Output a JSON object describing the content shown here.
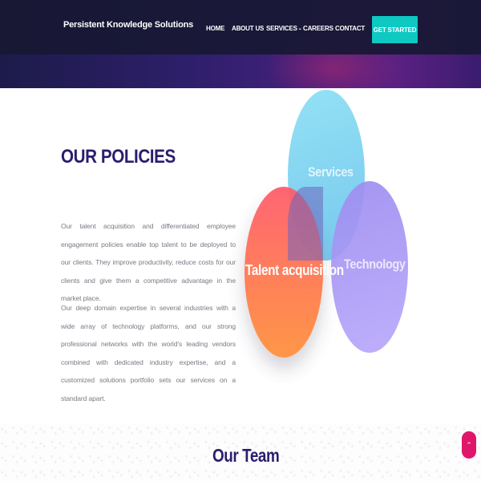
{
  "brand": {
    "name": "Persistent Knowledge Solutions"
  },
  "nav": {
    "items": [
      "HOME",
      "ABOUT US",
      "SERVICES",
      "CAREERS",
      "CONTACT"
    ],
    "cta_label": "GET STARTED"
  },
  "policies": {
    "title": "OUR POLICIES",
    "paragraphs": [
      "Our talent acquisition and differentiated employee engagement policies enable top talent to be deployed to our clients. They improve productivity, reduce costs for our clients and give them a competitive advantage in the market place.",
      "Our deep domain expertise in several industries with a wide array of technology platforms, and our strong professional networks with the world's leading vendors combined with dedicated industry expertise, and a customized solutions portfolio sets our services on a standard apart."
    ]
  },
  "venn": {
    "services": "Services",
    "technology": "Technology",
    "talent": "Talent acquisition",
    "colors": {
      "services": "#8ee0f5",
      "technology": "#a897f5",
      "talent": "#ff6a55"
    }
  },
  "team": {
    "title": "Our Team"
  },
  "scroll_top": {
    "icon": "chevron-up-icon",
    "glyph": "⌃"
  },
  "colors": {
    "accent": "#0ec8c2",
    "heading": "#2b1d6e",
    "scroll_button": "#e0166a",
    "navbar": "#18183a"
  }
}
